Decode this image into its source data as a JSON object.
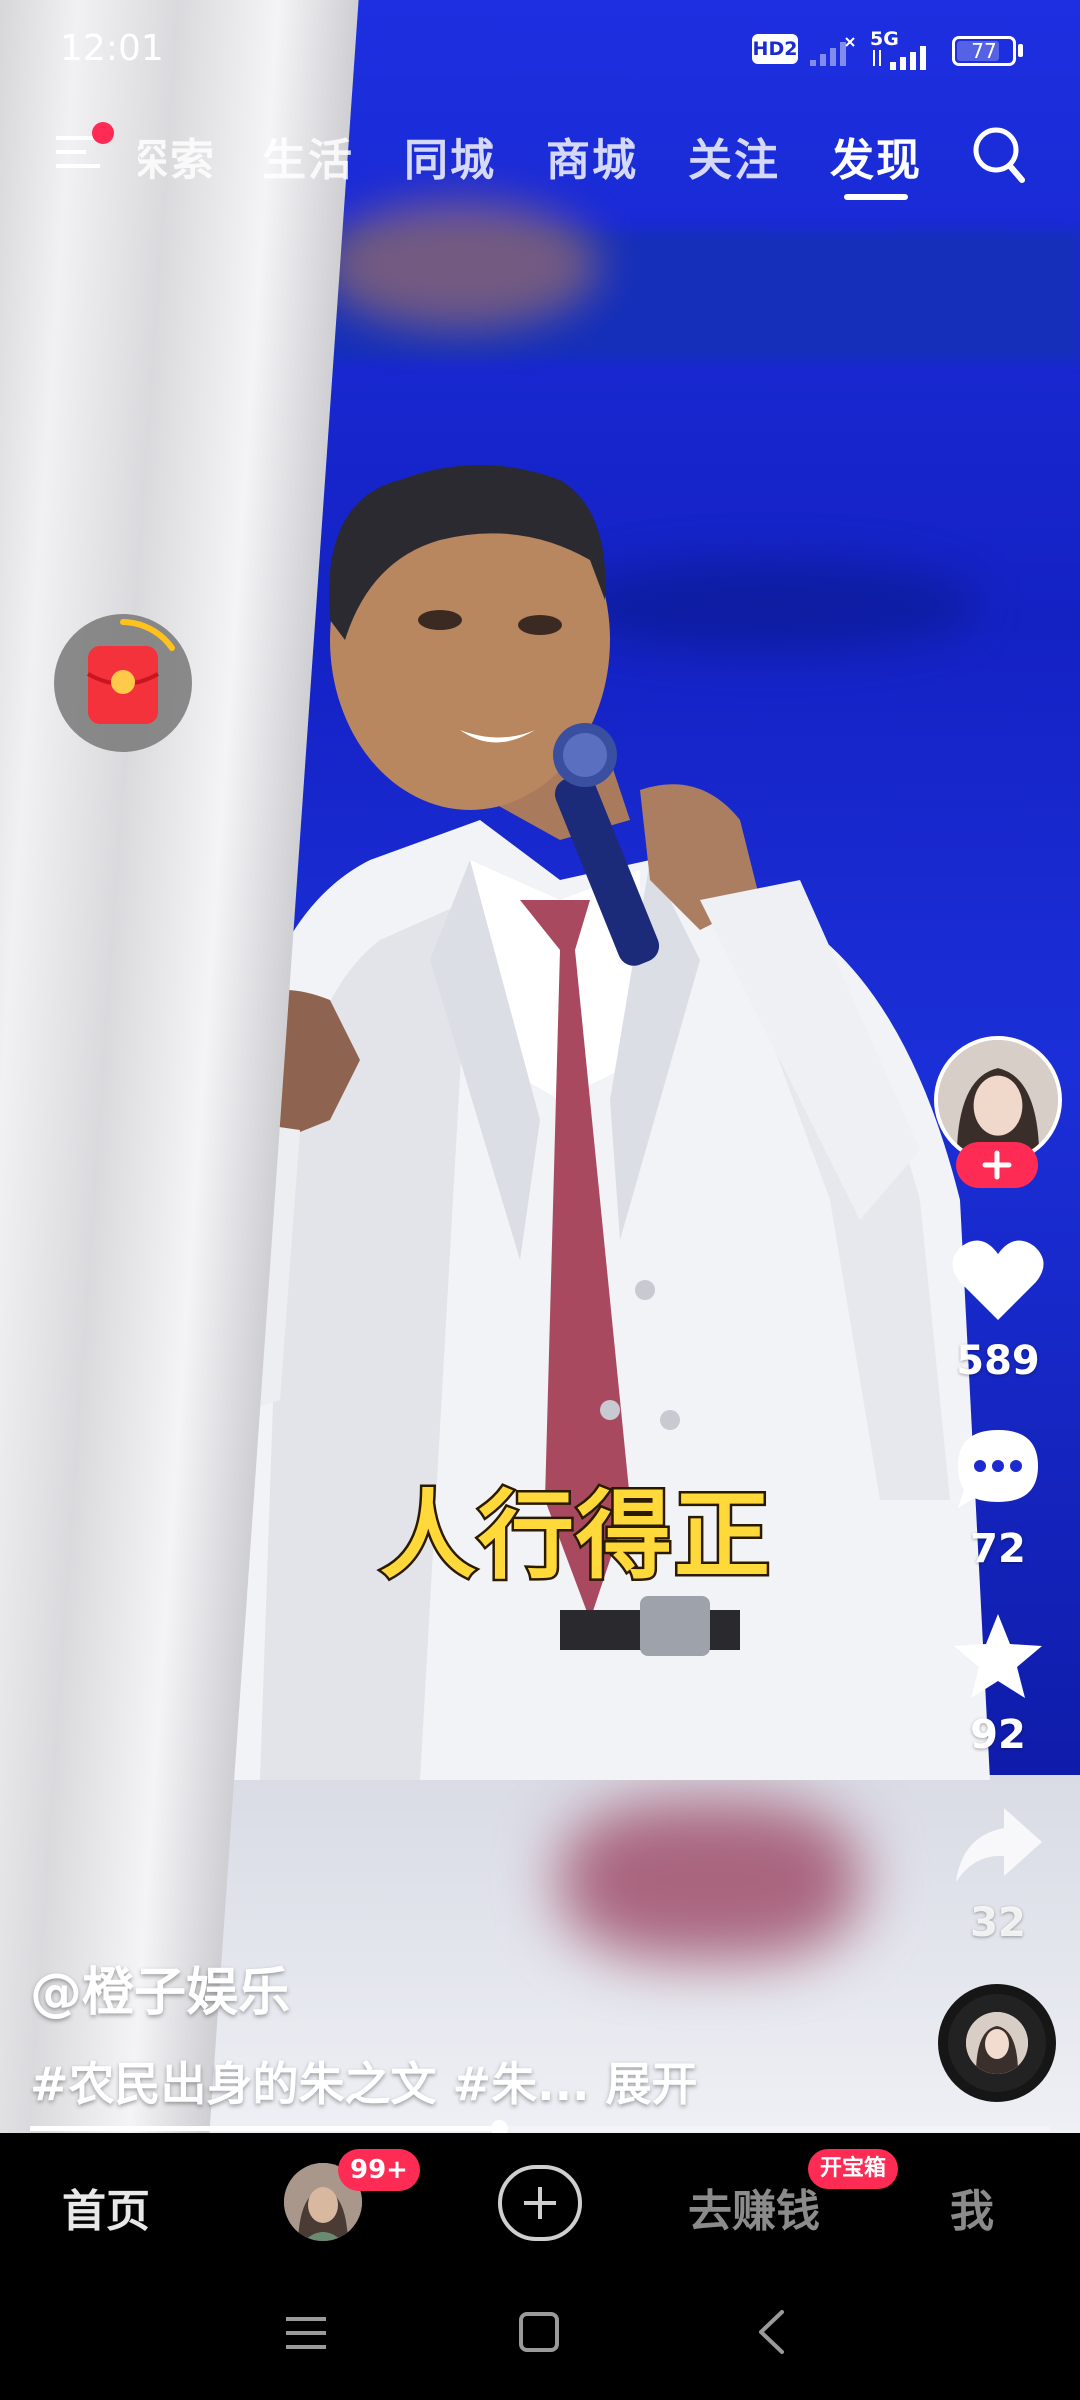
{
  "status_bar": {
    "time": "12:01",
    "hd_badge": "HD2",
    "network_generation": "5G",
    "battery_level": "77",
    "battery_fraction": 0.77
  },
  "top_nav": {
    "tabs": [
      {
        "label": "探索",
        "active": false
      },
      {
        "label": "生活",
        "active": false
      },
      {
        "label": "同城",
        "active": false
      },
      {
        "label": "商城",
        "active": false
      },
      {
        "label": "关注",
        "active": false
      },
      {
        "label": "发现",
        "active": true
      }
    ],
    "menu_icon": "menu-icon",
    "search_icon": "search-icon",
    "has_notification_dot": true
  },
  "video": {
    "subtitle": "人行得正",
    "author": "@橙子娱乐",
    "description_tag": "#农民出身的朱之文 #朱...",
    "expand_label": "展开",
    "progress_fraction": 0.46
  },
  "actions": {
    "like_count": "589",
    "comment_count": "72",
    "favorite_count": "92",
    "share_count": "32"
  },
  "bottom_tabs": {
    "home": "首页",
    "friends_badge": "99+",
    "earn": "去赚钱",
    "earn_badge": "开宝箱",
    "me": "我"
  },
  "colors": {
    "accent": "#fe2c55",
    "video_background": "#1a22c8",
    "subtitle_fill": "#ffd83a"
  }
}
